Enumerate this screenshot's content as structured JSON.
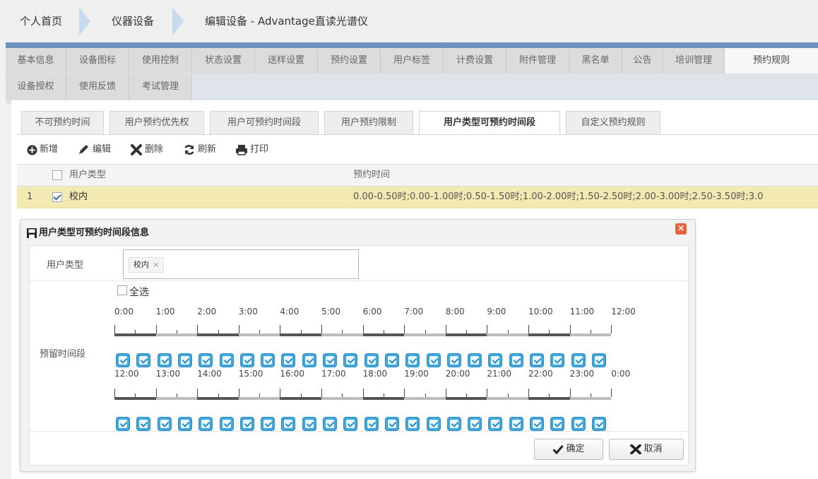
{
  "breadcrumb": {
    "items": [
      "个人首页",
      "仪器设备",
      "编辑设备 - Advantage直读光谱仪"
    ]
  },
  "main_tabs": {
    "row1": [
      "基本信息",
      "设备图标",
      "使用控制",
      "状态设置",
      "送样设置",
      "预约设置",
      "用户标签",
      "计费设置",
      "附件管理",
      "黑名单",
      "公告",
      "培训管理",
      "预约规则"
    ],
    "row2": [
      "设备授权",
      "使用反馈",
      "考试管理"
    ],
    "active": "预约规则"
  },
  "sub_tabs": {
    "items": [
      "不可预约时间",
      "用户预约优先权",
      "用户可预约时间段",
      "用户预约限制",
      "用户类型可预约时间段",
      "自定义预约规则"
    ],
    "active": "用户类型可预约时间段"
  },
  "toolbar": {
    "add": "新增",
    "edit": "编辑",
    "delete": "删除",
    "refresh": "刷新",
    "print": "打印"
  },
  "grid": {
    "headers": [
      "用户类型",
      "预约时间"
    ],
    "rows": [
      {
        "index": "1",
        "checked": true,
        "user_type": "校内",
        "time": "0.00-0.50时;0.00-1.00时;0.50-1.50时;1.00-2.00时;1.50-2.50时;2.00-3.00时;2.50-3.50时;3.0"
      }
    ]
  },
  "dialog": {
    "title": "用户类型可预约时间段信息",
    "user_type_label": "用户类型",
    "user_type_tag": "校内",
    "select_all_label": "全选",
    "slot_label": "预留时间段",
    "row1_times": [
      "0:00",
      "1:00",
      "2:00",
      "3:00",
      "4:00",
      "5:00",
      "6:00",
      "7:00",
      "8:00",
      "9:00",
      "10:00",
      "11:00",
      "12:00"
    ],
    "row2_times": [
      "12:00",
      "13:00",
      "14:00",
      "15:00",
      "16:00",
      "17:00",
      "18:00",
      "19:00",
      "20:00",
      "21:00",
      "22:00",
      "23:00",
      "0:00"
    ],
    "slots_checked_row1": 24,
    "slots_checked_row2": 24,
    "confirm": "确定",
    "cancel": "取消"
  },
  "colors": {
    "header_bar": "#6e93be",
    "selected_row": "#f3e9b2",
    "slot_checked": "#3fa7dc",
    "close_button": "#e8603c"
  }
}
